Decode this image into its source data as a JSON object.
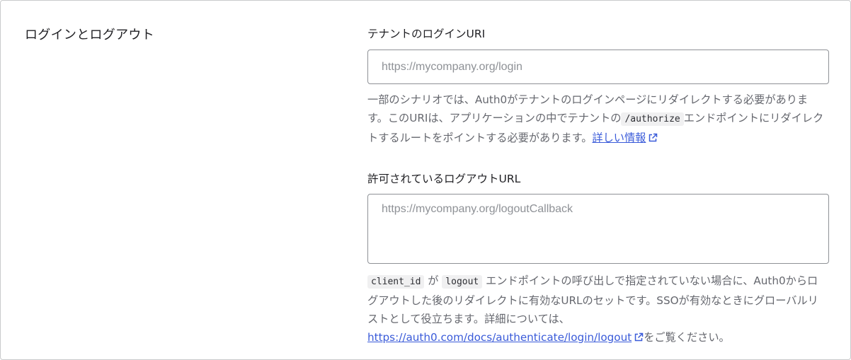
{
  "section": {
    "title": "ログインとログアウト"
  },
  "login_uri": {
    "label": "テナントのログインURI",
    "placeholder": "https://mycompany.org/login",
    "help_text_before": "一部のシナリオでは、Auth0がテナントのログインページにリダイレクトする必要があります。このURIは、アプリケーションの中でテナントの",
    "help_code": "/authorize",
    "help_text_after": "エンドポイントにリダイレクトするルートをポイントする必要があります。",
    "learn_more_link": "詳しい情報",
    "learn_more_icon": "external-link-icon"
  },
  "logout_urls": {
    "label": "許可されているログアウトURL",
    "placeholder": "https://mycompany.org/logoutCallback",
    "help_code_1": "client_id",
    "help_text_1": "が",
    "help_code_2": "logout",
    "help_text_2": "エンドポイントの呼び出しで指定されていない場合に、Auth0からログアウトした後のリダイレクトに有効なURLのセットです。SSOが有効なときにグローバルリストとして役立ちます。詳細については、",
    "docs_link": "https://auth0.com/docs/authenticate/login/logout",
    "docs_icon": "external-link-icon",
    "help_text_3": "をご覧ください。"
  },
  "colors": {
    "link": "#3a5bd9",
    "border": "#c9cacc",
    "help_text": "#65676e"
  }
}
